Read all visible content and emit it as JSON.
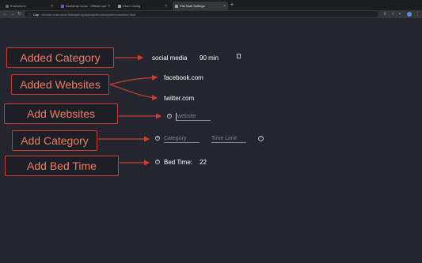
{
  "browser": {
    "tabs": [
      {
        "label": "Extensions",
        "favicon_color": "#5f6368"
      },
      {
        "label": "Bootstrap Icons · Official ope",
        "favicon_color": "#7952b3"
      },
      {
        "label": "Store Listing",
        "favicon_color": "#9aa0a6"
      },
      {
        "label": "Fail-Safe Settings",
        "favicon_color": "#9aa0a6"
      }
    ],
    "active_tab": 3,
    "address": {
      "chip": "Cap",
      "url": "chrome-extension://fabolpholgcjkjacfpcfeommdgdd9/extension.html"
    }
  },
  "callouts": {
    "added_category": "Added Category",
    "added_websites": "Added Websites",
    "add_websites": "Add Websites",
    "add_category": "Add Category",
    "add_bed_time": "Add Bed Time"
  },
  "settings": {
    "category": {
      "name": "social media",
      "time": "90 min"
    },
    "websites": [
      "facebook.com",
      "twitter.com"
    ],
    "website_placeholder": "website",
    "category_placeholder": "Category",
    "time_limit_placeholder": "Time Limit",
    "bed_time_label": "Bed Time:",
    "bed_time_value": "22"
  },
  "colors": {
    "accent": "#cf3b2e",
    "callout_text": "#f07a63",
    "background": "#23252f"
  }
}
